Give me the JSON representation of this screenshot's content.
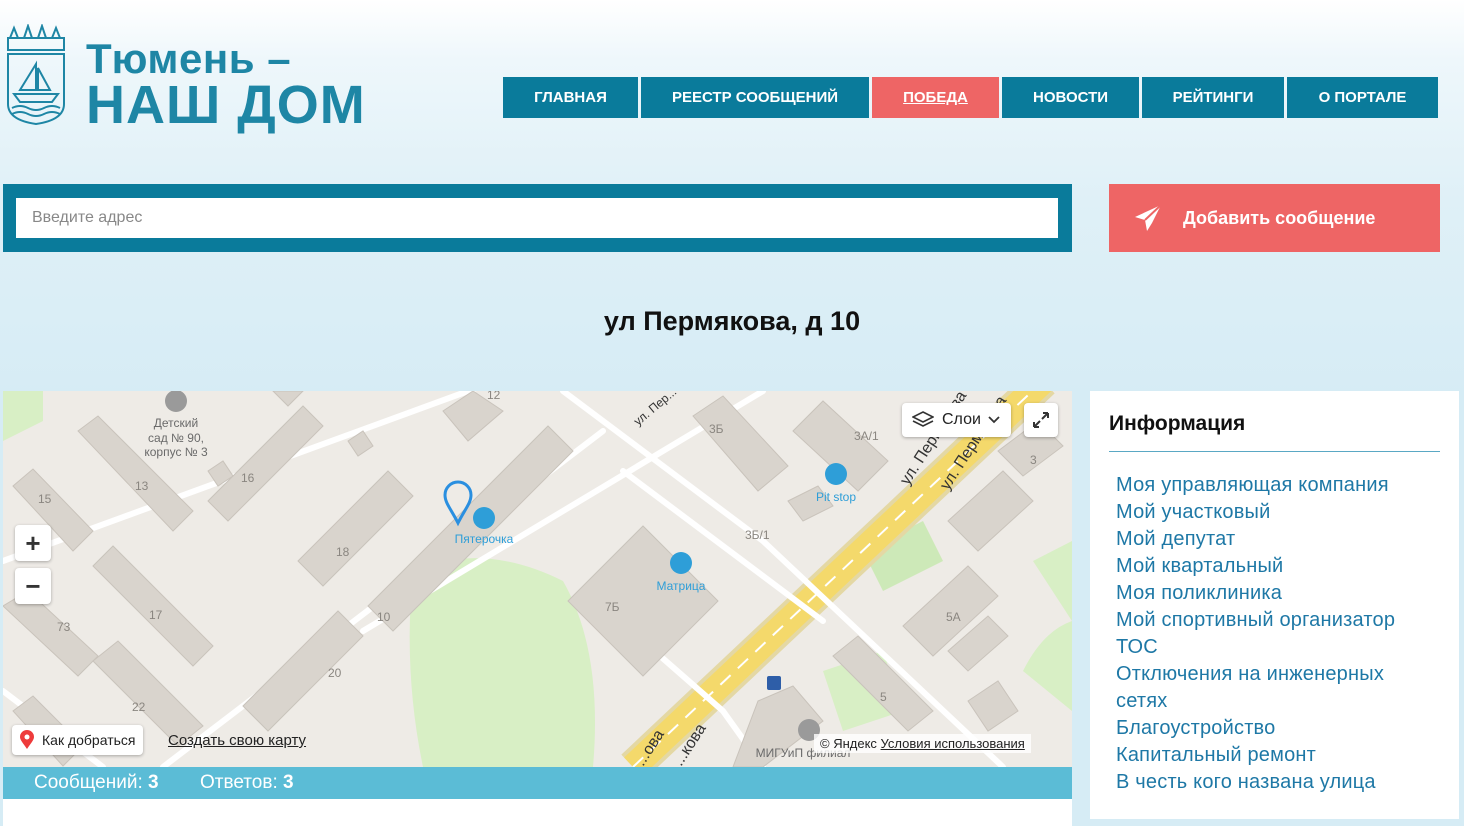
{
  "logo": {
    "line1": "Тюмень –",
    "line2": "НАШ ДОМ",
    "emblem_icon": "city-coat-of-arms-icon"
  },
  "nav": [
    {
      "label": "ГЛАВНАЯ",
      "active": false
    },
    {
      "label": "РЕЕСТР СООБЩЕНИЙ",
      "active": false
    },
    {
      "label": "ПОБЕДА",
      "active": true
    },
    {
      "label": "НОВОСТИ",
      "active": false
    },
    {
      "label": "РЕЙТИНГИ",
      "active": false
    },
    {
      "label": "О ПОРТАЛЕ",
      "active": false
    }
  ],
  "search": {
    "placeholder": "Введите адрес",
    "value": ""
  },
  "add_message": {
    "label": "Добавить сообщение",
    "icon": "paper-plane-icon"
  },
  "address_title": "ул Пермякова, д 10",
  "map": {
    "layers_label": "Слои",
    "route_label": "Как добраться",
    "own_map_label": "Создать свою карту",
    "copyright": "© Яндекс",
    "terms_label": "Условия использования",
    "labels": {
      "kindergarten": [
        "Детский",
        "сад № 90,",
        "корпус № 3"
      ],
      "shop1": "Пятерочка",
      "shop2": "Матрица",
      "pitstop": "Pit stop",
      "migu": "МИГУиП филиал",
      "street1": "ул. Пермякова",
      "street2": "ул. Пермякова",
      "street3": "ул. Пер...",
      "street4": "...ова",
      "street5": "...кова"
    },
    "house_numbers": [
      "12",
      "13",
      "15",
      "16",
      "18",
      "17",
      "73",
      "10",
      "20",
      "22",
      "3Б",
      "3А/1",
      "3Б/1",
      "7Б",
      "3",
      "5А",
      "5"
    ]
  },
  "stats": {
    "messages_label": "Сообщений:",
    "messages_count": "3",
    "answers_label": "Ответов:",
    "answers_count": "3"
  },
  "info": {
    "title": "Информация",
    "links": [
      "Моя управляющая компания",
      "Мой участковый",
      "Мой депутат",
      "Мой квартальный",
      "Моя поликлиника",
      "Мой спортивный организатор",
      "ТОС",
      "Отключения на инженерных",
      "сетях",
      "Благоустройство",
      "Капитальный ремонт",
      "В честь кого названа улица"
    ]
  }
}
